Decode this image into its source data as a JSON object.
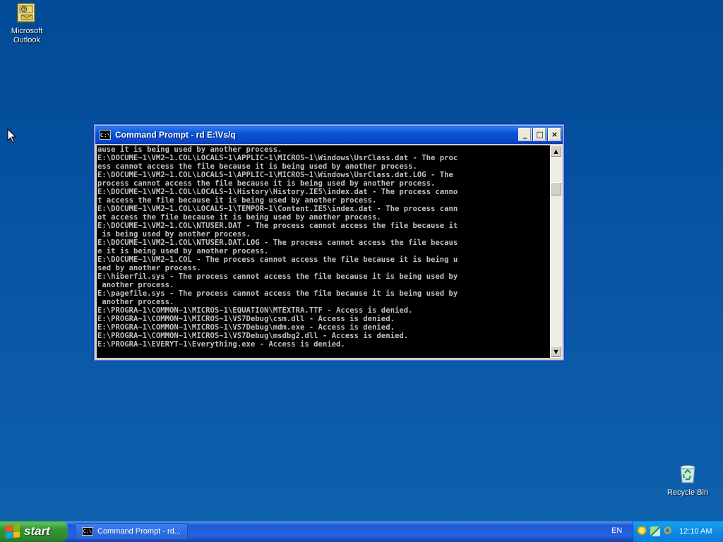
{
  "desktop": {
    "icons": [
      {
        "label": "Microsoft Outlook",
        "icon": "outlook-icon"
      },
      {
        "label": "Recycle Bin",
        "icon": "recycle-bin-icon"
      }
    ]
  },
  "window": {
    "title": "Command Prompt - rd E:\\Vs/q",
    "buttons": {
      "minimize": "_",
      "maximize": "□",
      "close": "×"
    },
    "console_lines": [
      "ause it is being used by another process.",
      "E:\\DOCUME~1\\VM2~1.COL\\LOCALS~1\\APPLIC~1\\MICROS~1\\Windows\\UsrClass.dat - The proc",
      "ess cannot access the file because it is being used by another process.",
      "E:\\DOCUME~1\\VM2~1.COL\\LOCALS~1\\APPLIC~1\\MICROS~1\\Windows\\UsrClass.dat.LOG - The",
      "process cannot access the file because it is being used by another process.",
      "E:\\DOCUME~1\\VM2~1.COL\\LOCALS~1\\History\\History.IE5\\index.dat - The process canno",
      "t access the file because it is being used by another process.",
      "E:\\DOCUME~1\\VM2~1.COL\\LOCALS~1\\TEMPOR~1\\Content.IE5\\index.dat - The process cann",
      "ot access the file because it is being used by another process.",
      "E:\\DOCUME~1\\VM2~1.COL\\NTUSER.DAT - The process cannot access the file because it",
      " is being used by another process.",
      "E:\\DOCUME~1\\VM2~1.COL\\NTUSER.DAT.LOG - The process cannot access the file becaus",
      "e it is being used by another process.",
      "E:\\DOCUME~1\\VM2~1.COL - The process cannot access the file because it is being u",
      "sed by another process.",
      "E:\\hiberfil.sys - The process cannot access the file because it is being used by",
      " another process.",
      "E:\\pagefile.sys - The process cannot access the file because it is being used by",
      " another process.",
      "E:\\PROGRA~1\\COMMON~1\\MICROS~1\\EQUATION\\MTEXTRA.TTF - Access is denied.",
      "E:\\PROGRA~1\\COMMON~1\\MICROS~1\\VS7Debug\\csm.dll - Access is denied.",
      "E:\\PROGRA~1\\COMMON~1\\MICROS~1\\VS7Debug\\mdm.exe - Access is denied.",
      "E:\\PROGRA~1\\COMMON~1\\MICROS~1\\VS7Debug\\msdbg2.dll - Access is denied.",
      "E:\\PROGRA~1\\EVERYT~1\\Everything.exe - Access is denied."
    ]
  },
  "taskbar": {
    "start_label": "start",
    "task_label": "Command Prompt - rd...",
    "language": "EN",
    "clock": "12:10 AM"
  },
  "colors": {
    "desktop": "#0a58a6",
    "console_bg": "#000000",
    "console_text": "#c0c0c0",
    "title_bar": "#0a54d8"
  }
}
